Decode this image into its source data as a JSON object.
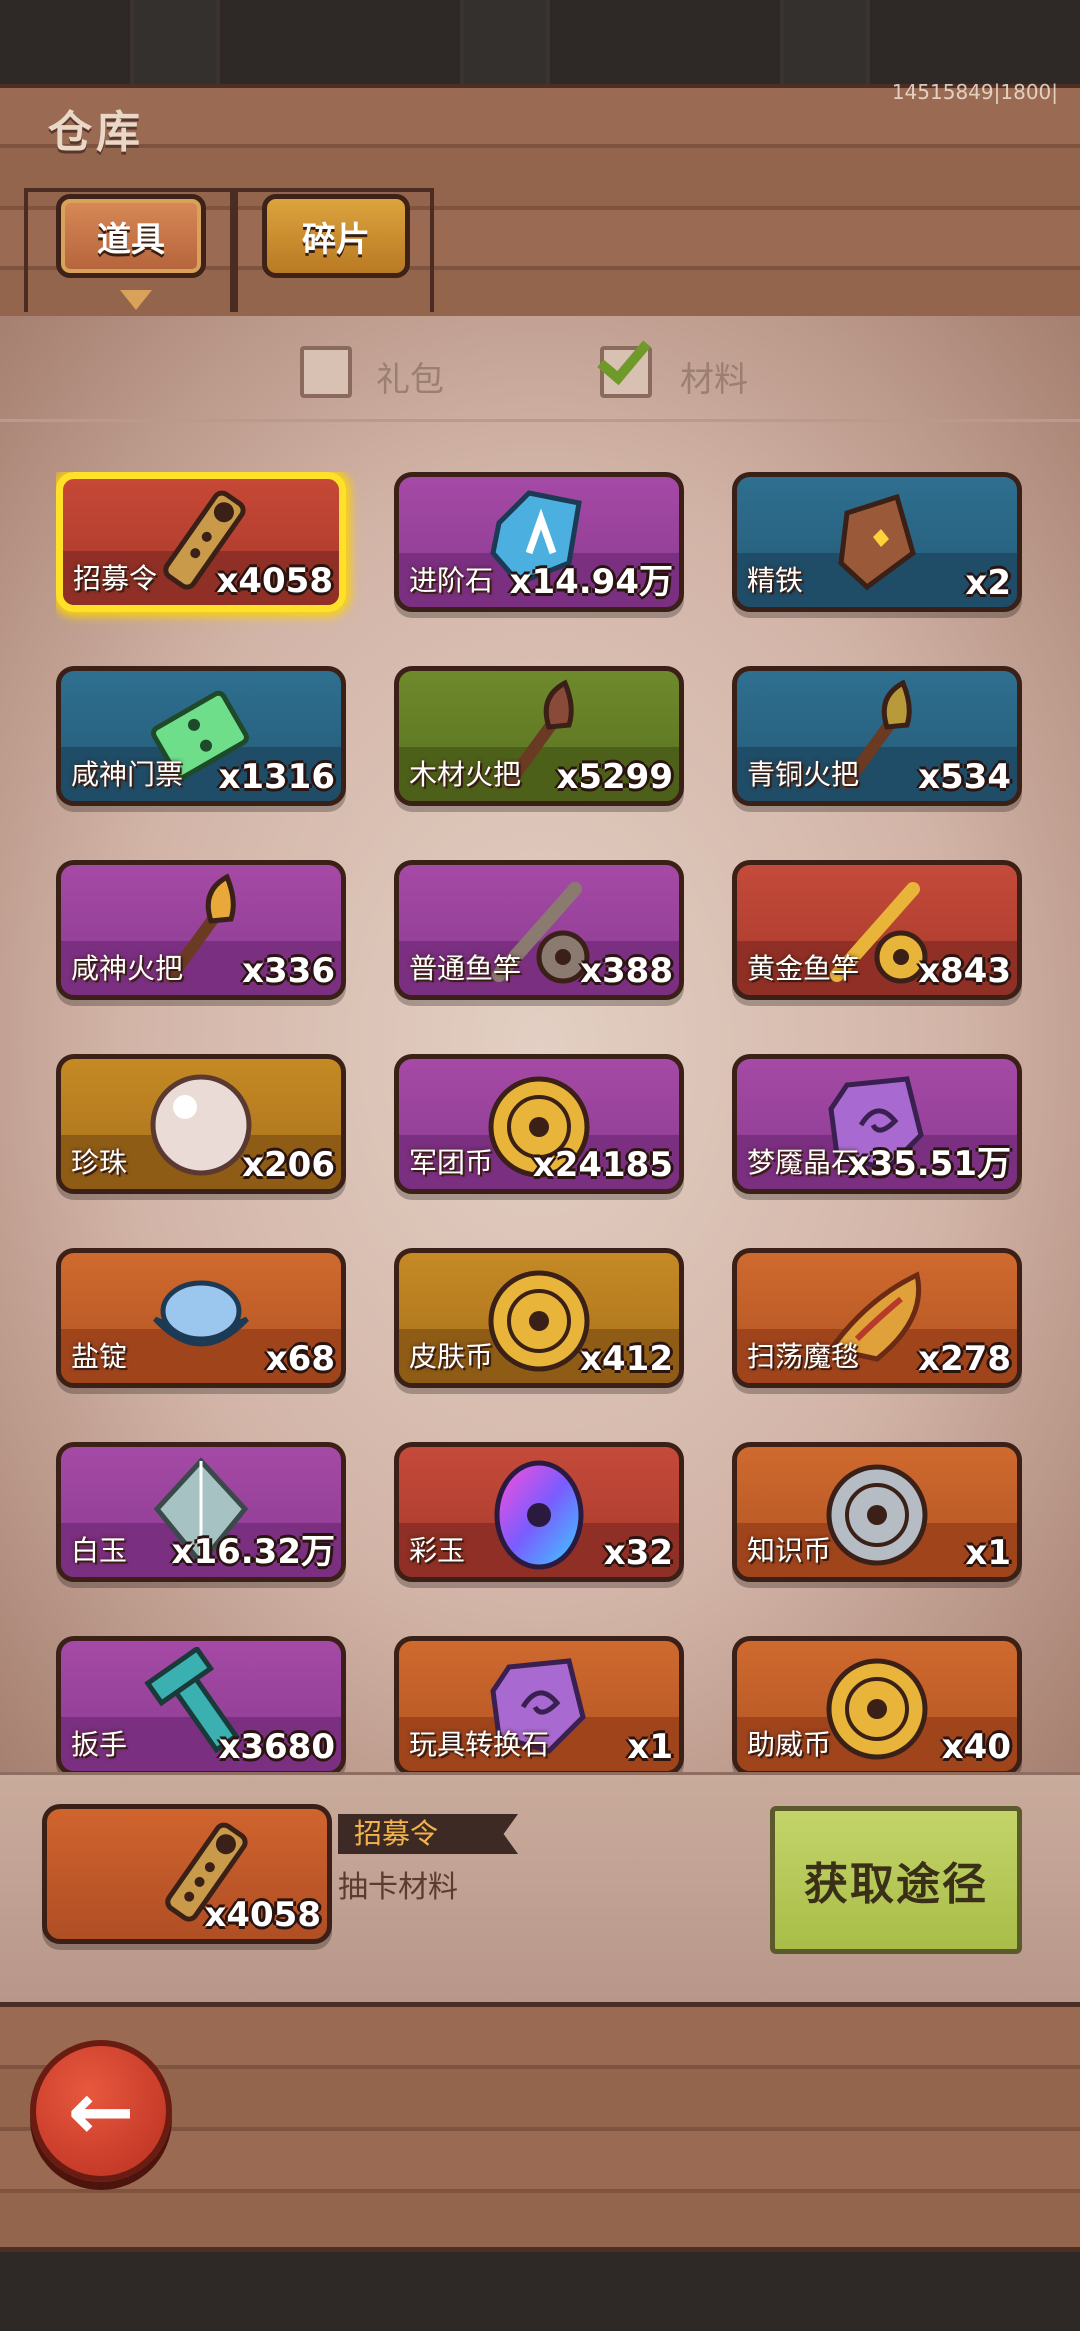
{
  "header": {
    "title": "仓库",
    "server_id": "14515849|1800|"
  },
  "tabs": [
    {
      "label": "道具",
      "active": true
    },
    {
      "label": "碎片",
      "active": false
    }
  ],
  "filters": [
    {
      "label": "礼包",
      "checked": false
    },
    {
      "label": "材料",
      "checked": true
    }
  ],
  "items": [
    {
      "name": "招募令",
      "qty": "x4058",
      "color": "red",
      "icon": "recruit-token-icon",
      "selected": true
    },
    {
      "name": "进阶石",
      "qty": "x14.94万",
      "color": "purple",
      "icon": "advance-stone-icon"
    },
    {
      "name": "精铁",
      "qty": "x2",
      "color": "blue",
      "icon": "iron-ingot-icon"
    },
    {
      "name": "咸神门票",
      "qty": "x1316",
      "color": "blue",
      "icon": "ticket-icon"
    },
    {
      "name": "木材火把",
      "qty": "x5299",
      "color": "green",
      "icon": "wood-torch-icon"
    },
    {
      "name": "青铜火把",
      "qty": "x534",
      "color": "blue",
      "icon": "bronze-torch-icon"
    },
    {
      "name": "咸神火把",
      "qty": "x336",
      "color": "purple",
      "icon": "golden-torch-icon"
    },
    {
      "name": "普通鱼竿",
      "qty": "x388",
      "color": "purple",
      "icon": "fishing-rod-icon"
    },
    {
      "name": "黄金鱼竿",
      "qty": "x843",
      "color": "red",
      "icon": "golden-fishing-rod-icon"
    },
    {
      "name": "珍珠",
      "qty": "x206",
      "color": "gold",
      "icon": "pearl-icon"
    },
    {
      "name": "军团币",
      "qty": "x24185",
      "color": "purple",
      "icon": "legion-coin-icon"
    },
    {
      "name": "梦魇晶石",
      "qty": "x35.51万",
      "color": "purple",
      "icon": "nightmare-crystal-icon"
    },
    {
      "name": "盐锭",
      "qty": "x68",
      "color": "orange",
      "icon": "salt-ingot-icon"
    },
    {
      "name": "皮肤币",
      "qty": "x412",
      "color": "gold",
      "icon": "skin-coin-icon"
    },
    {
      "name": "扫荡魔毯",
      "qty": "x278",
      "color": "orange",
      "icon": "magic-carpet-icon"
    },
    {
      "name": "白玉",
      "qty": "x16.32万",
      "color": "purple",
      "icon": "white-jade-icon"
    },
    {
      "name": "彩玉",
      "qty": "x32",
      "color": "red",
      "icon": "rainbow-jade-icon"
    },
    {
      "name": "知识币",
      "qty": "x1",
      "color": "orange",
      "icon": "knowledge-coin-icon"
    },
    {
      "name": "扳手",
      "qty": "x3680",
      "color": "purple",
      "icon": "wrench-icon"
    },
    {
      "name": "玩具转换石",
      "qty": "x1",
      "color": "orange",
      "icon": "toy-stone-icon"
    },
    {
      "name": "助威币",
      "qty": "x40",
      "color": "orange",
      "icon": "cheer-coin-icon"
    }
  ],
  "detail": {
    "name": "招募令",
    "desc": "抽卡材料",
    "qty": "x4058",
    "icon": "recruit-token-icon",
    "obtain_label": "获取途径"
  },
  "nav": {
    "back_icon": "back-arrow-icon"
  }
}
